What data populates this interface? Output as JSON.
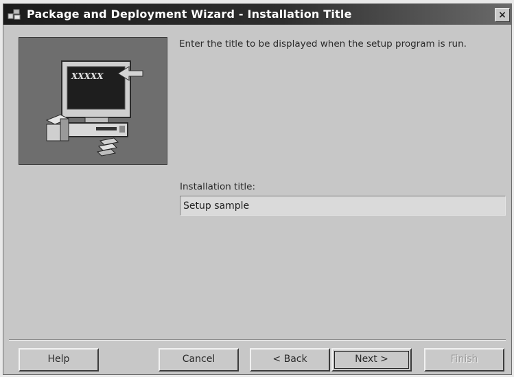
{
  "window": {
    "title": "Package and Deployment Wizard - Installation Title",
    "close_label": "×"
  },
  "picture": {
    "screen_text": "XXXXX"
  },
  "main": {
    "instruction": "Enter the title to be displayed when the setup program is run.",
    "field_label": "Installation title:",
    "field_value": "Setup sample"
  },
  "buttons": {
    "help": "Help",
    "cancel": "Cancel",
    "back": "< Back",
    "next": "Next >",
    "finish": "Finish"
  }
}
